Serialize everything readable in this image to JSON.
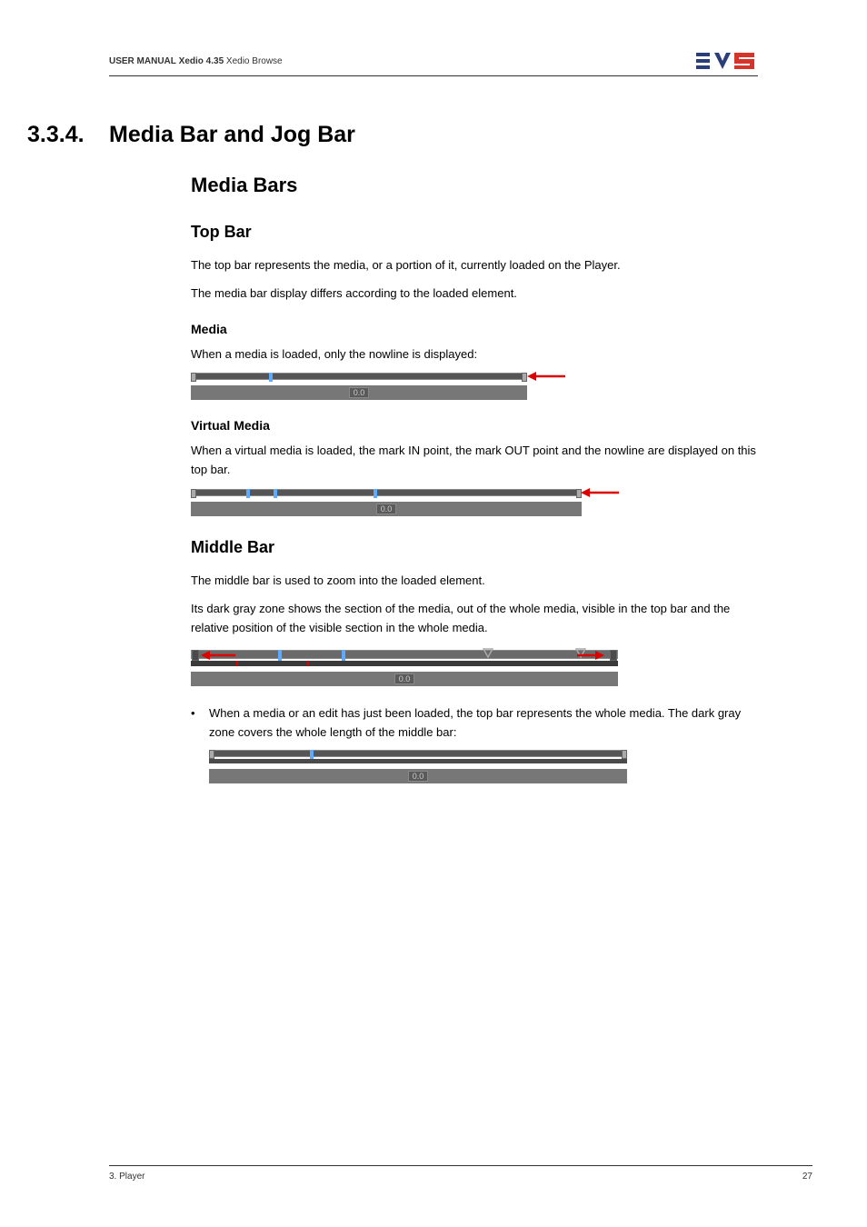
{
  "header": {
    "manual_label": "USER MANUAL",
    "product": "Xedio 4.35",
    "component": "Xedio Browse"
  },
  "section": {
    "number": "3.3.4.",
    "title": "Media Bar and Jog Bar"
  },
  "h2_media_bars": "Media Bars",
  "top_bar": {
    "heading": "Top Bar",
    "p1": "The top bar represents the media, or a portion of it, currently loaded on the Player.",
    "p2": "The media bar display differs according to the loaded element."
  },
  "media": {
    "heading": "Media",
    "p1": "When a media is loaded, only the nowline is displayed:",
    "jog_value": "0.0"
  },
  "virtual_media": {
    "heading": "Virtual Media",
    "p1": "When a virtual media is loaded, the mark IN point, the mark OUT point and the nowline are displayed on this top bar.",
    "jog_value": "0.0"
  },
  "middle_bar": {
    "heading": "Middle Bar",
    "p1": "The middle bar is used to zoom into the loaded element.",
    "p2": "Its dark gray zone shows the section of the media, out of the whole media, visible in the top bar and the relative position of the visible section in the whole media.",
    "jog_value": "0.0",
    "bullet1": "When a media or an edit has just been loaded, the top bar represents the whole media. The dark gray zone covers the whole length of the middle bar:",
    "jog_value2": "0.0"
  },
  "footer": {
    "left": "3. Player",
    "right": "27"
  }
}
